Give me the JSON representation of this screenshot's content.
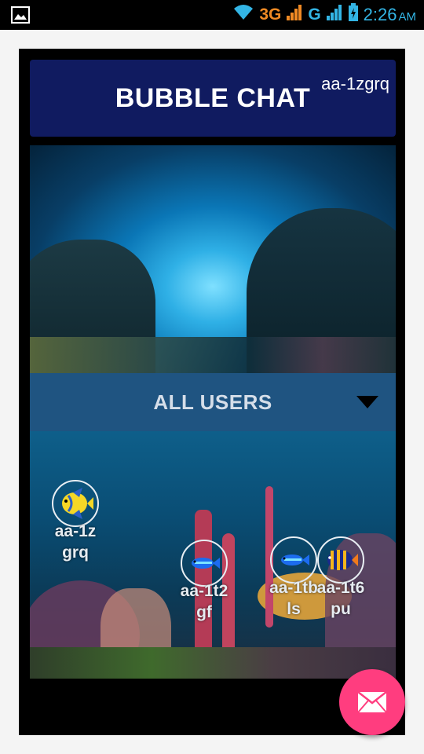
{
  "status_bar": {
    "network_1": "3G",
    "network_2": "G",
    "time": "2:26",
    "ampm": "AM",
    "accent": "#33b5e5"
  },
  "header": {
    "title": "BUBBLE CHAT",
    "current_user": "aa-1zgrq"
  },
  "dropdown": {
    "selected": "ALL USERS"
  },
  "users": [
    {
      "name": "aa-1zgrq",
      "icon": "angelfish-yellow"
    },
    {
      "name": "aa-1t2gf",
      "icon": "fish-blue"
    },
    {
      "name": "aa-1tbls",
      "icon": "fish-blue"
    },
    {
      "name": "aa-1t6pu",
      "icon": "fish-striped"
    }
  ],
  "fab": {
    "icon": "envelope-icon",
    "color": "#ff3d7f"
  }
}
